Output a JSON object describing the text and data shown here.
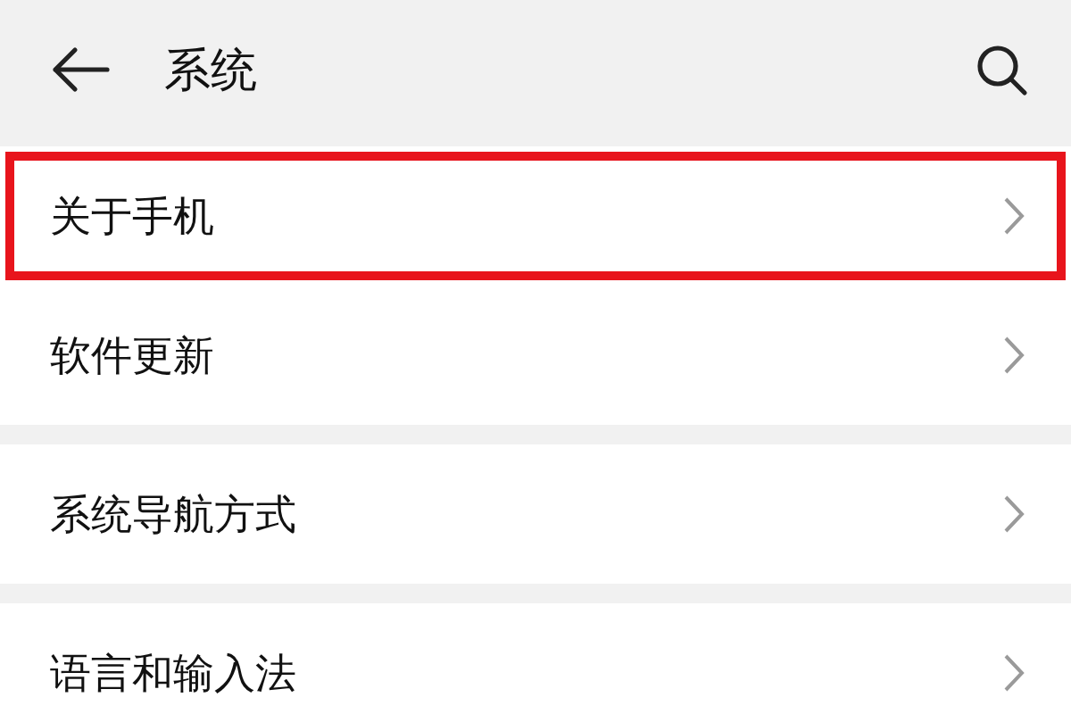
{
  "header": {
    "title": "系统"
  },
  "groups": [
    {
      "items": [
        {
          "label": "关于手机",
          "highlighted": true
        },
        {
          "label": "软件更新",
          "highlighted": false
        }
      ]
    },
    {
      "items": [
        {
          "label": "系统导航方式",
          "highlighted": false
        }
      ]
    },
    {
      "items": [
        {
          "label": "语言和输入法",
          "highlighted": false
        }
      ]
    }
  ]
}
